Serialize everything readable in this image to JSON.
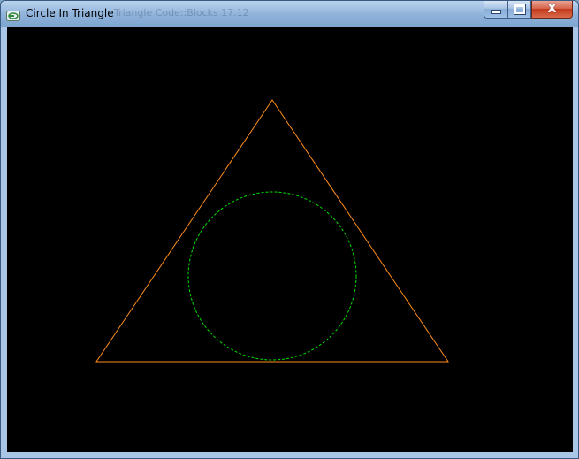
{
  "window": {
    "title": "Circle In Triangle",
    "title_ghost": "Triangle  Code::Blocks 17.12"
  },
  "caption_buttons": {
    "close_label": "X"
  },
  "colors": {
    "background": "#000000",
    "triangle_stroke": "#ff8c1a",
    "circle_stroke": "#00e000"
  }
}
